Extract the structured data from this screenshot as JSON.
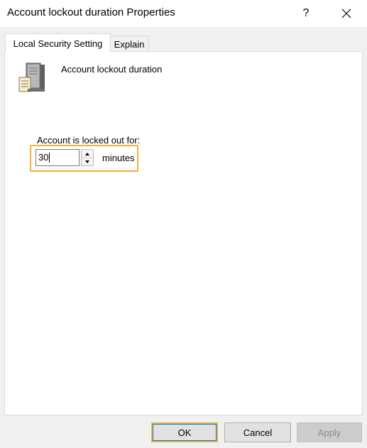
{
  "window": {
    "title": "Account lockout duration Properties",
    "help_label": "?"
  },
  "tabs": [
    {
      "label": "Local Security Setting",
      "active": true
    },
    {
      "label": "Explain",
      "active": false
    }
  ],
  "policy": {
    "name": "Account lockout duration",
    "icon": "server-policy-icon"
  },
  "lockout": {
    "label": "Account is locked out for:",
    "value": "30",
    "unit": "minutes"
  },
  "buttons": {
    "ok": "OK",
    "cancel": "Cancel",
    "apply": "Apply"
  },
  "colors": {
    "highlight": "#f0b23a",
    "focus": "#0078d7",
    "disabled_text": "#8c8c8c"
  }
}
